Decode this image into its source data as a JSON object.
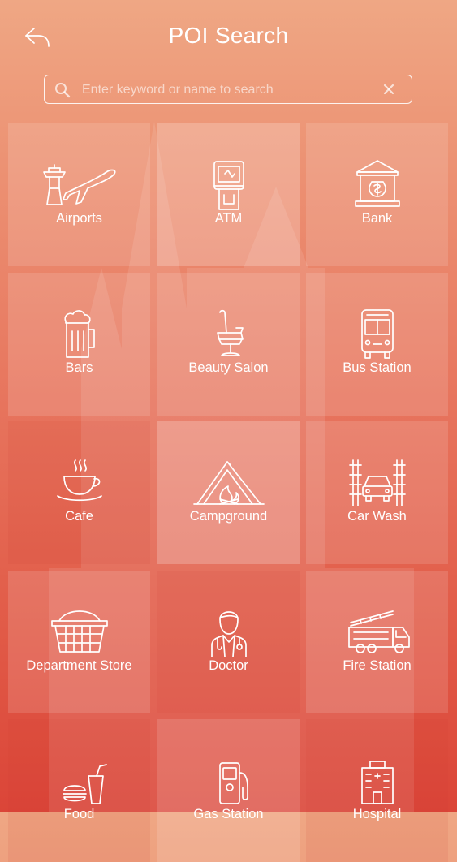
{
  "header": {
    "title": "POI Search",
    "back_icon": "back-arrow-icon"
  },
  "search": {
    "placeholder": "Enter keyword or name to search",
    "value": ""
  },
  "categories": [
    {
      "label": "Airports",
      "icon": "airport-icon"
    },
    {
      "label": "ATM",
      "icon": "atm-icon"
    },
    {
      "label": "Bank",
      "icon": "bank-icon"
    },
    {
      "label": "Bars",
      "icon": "beer-mug-icon"
    },
    {
      "label": "Beauty Salon",
      "icon": "salon-chair-icon"
    },
    {
      "label": "Bus Station",
      "icon": "bus-icon"
    },
    {
      "label": "Cafe",
      "icon": "coffee-cup-icon"
    },
    {
      "label": "Campground",
      "icon": "tent-icon"
    },
    {
      "label": "Car Wash",
      "icon": "car-wash-icon"
    },
    {
      "label": "Department Store",
      "icon": "basket-icon"
    },
    {
      "label": "Doctor",
      "icon": "doctor-icon"
    },
    {
      "label": "Fire Station",
      "icon": "fire-truck-icon"
    },
    {
      "label": "Food",
      "icon": "food-icon"
    },
    {
      "label": "Gas Station",
      "icon": "gas-pump-icon"
    },
    {
      "label": "Hospital",
      "icon": "hospital-icon"
    }
  ],
  "theme": {
    "accent": "#e7745d",
    "text": "#ffffff"
  }
}
